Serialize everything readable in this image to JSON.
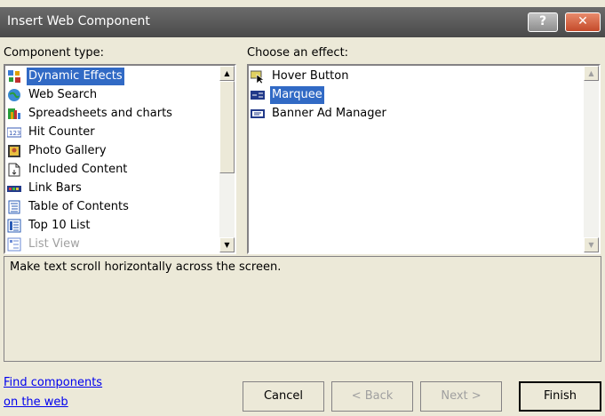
{
  "dialog": {
    "title": "Insert Web Component",
    "help_glyph": "?",
    "close_glyph": "✕"
  },
  "component_type": {
    "label": "Component type:",
    "items": [
      {
        "label": "Dynamic Effects",
        "icon": "dynamic-effects-icon",
        "state": "selected"
      },
      {
        "label": "Web Search",
        "icon": "web-search-icon"
      },
      {
        "label": "Spreadsheets and charts",
        "icon": "spreadsheets-icon"
      },
      {
        "label": "Hit Counter",
        "icon": "hit-counter-icon"
      },
      {
        "label": "Photo Gallery",
        "icon": "photo-gallery-icon"
      },
      {
        "label": "Included Content",
        "icon": "included-content-icon"
      },
      {
        "label": "Link Bars",
        "icon": "link-bars-icon"
      },
      {
        "label": "Table of Contents",
        "icon": "table-of-contents-icon"
      },
      {
        "label": "Top 10 List",
        "icon": "top-10-list-icon"
      },
      {
        "label": "List View",
        "icon": "list-view-icon",
        "state": "partially-visible"
      }
    ]
  },
  "effects": {
    "label": "Choose an effect:",
    "items": [
      {
        "label": "Hover Button",
        "icon": "hover-button-icon"
      },
      {
        "label": "Marquee",
        "icon": "marquee-icon",
        "state": "selected"
      },
      {
        "label": "Banner Ad Manager",
        "icon": "banner-ad-icon"
      }
    ]
  },
  "description": "Make text scroll horizontally across the screen.",
  "find_components": {
    "line1": "Find components",
    "line2": "on the web"
  },
  "buttons": {
    "cancel": "Cancel",
    "back": "< Back",
    "next": "Next >",
    "finish": "Finish"
  },
  "colors": {
    "selection": "#316ac5",
    "dialog_bg": "#ece9d8",
    "link": "#0000ee"
  }
}
